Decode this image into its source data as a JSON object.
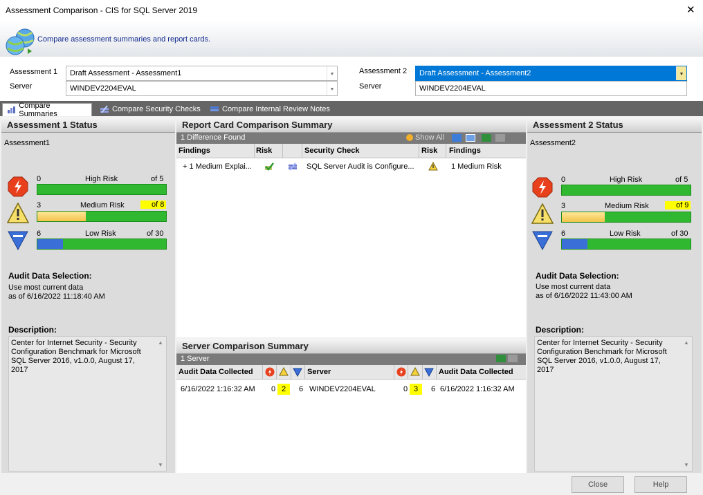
{
  "window": {
    "title": "Assessment Comparison - CIS for SQL Server 2019",
    "close_glyph": "✕"
  },
  "header": {
    "text": "Compare assessment summaries and report cards."
  },
  "selection": {
    "a1_label": "Assessment 1",
    "a1_server_label": "Server",
    "a1_value": "Draft Assessment - Assessment1",
    "a1_server": "WINDEV2204EVAL",
    "a2_label": "Assessment 2",
    "a2_server_label": "Server",
    "a2_value": "Draft Assessment - Assessment2",
    "a2_server": "WINDEV2204EVAL"
  },
  "tabs": [
    {
      "label": "Compare Summaries"
    },
    {
      "label": "Compare Security Checks"
    },
    {
      "label": "Compare Internal Review Notes"
    }
  ],
  "left": {
    "title": "Assessment 1 Status",
    "name": "Assessment1",
    "high": {
      "count": "0",
      "label": "High Risk",
      "of": "of 5",
      "fraction": 0
    },
    "medium": {
      "count": "3",
      "label": "Medium Risk",
      "of": "of 8",
      "fraction": 0.375
    },
    "low": {
      "count": "6",
      "label": "Low Risk",
      "of": "of 30",
      "fraction": 0.2
    },
    "audit_heading": "Audit Data Selection:",
    "audit_line1": "Use most current data",
    "audit_line2": "as of 6/16/2022 11:18:40 AM",
    "desc_heading": "Description:",
    "desc": "Center for Internet Security - Security Configuration Benchmark for Microsoft SQL Server 2016, v1.0.0, August 17, 2017"
  },
  "right": {
    "title": "Assessment 2 Status",
    "name": "Assessment2",
    "high": {
      "count": "0",
      "label": "High Risk",
      "of": "of 5",
      "fraction": 0
    },
    "medium": {
      "count": "3",
      "label": "Medium Risk",
      "of": "of 9",
      "fraction": 0.333
    },
    "low": {
      "count": "6",
      "label": "Low Risk",
      "of": "of 30",
      "fraction": 0.2
    },
    "audit_heading": "Audit Data Selection:",
    "audit_line1": "Use most current data",
    "audit_line2": "as of 6/16/2022 11:43:00 AM",
    "desc_heading": "Description:",
    "desc": "Center for Internet Security - Security Configuration Benchmark for Microsoft SQL Server 2016, v1.0.0, August 17, 2017"
  },
  "report": {
    "title": "Report Card Comparison Summary",
    "found": "1 Difference Found",
    "show_all": "Show All",
    "headers": [
      "Findings",
      "Risk",
      "Security Check",
      "Risk",
      "Findings"
    ],
    "row": {
      "findings1": "+ 1 Medium Explai...",
      "check": "SQL Server Audit is Configure...",
      "findings2": "1 Medium Risk"
    }
  },
  "server": {
    "title": "Server Comparison Summary",
    "count": "1 Server",
    "headers": {
      "audit1": "Audit Data Collected",
      "server": "Server",
      "audit2": "Audit Data Collected"
    },
    "row": {
      "date1": "6/16/2022 1:16:32 AM",
      "h1": "0",
      "m1": "2",
      "l1": "6",
      "server": "WINDEV2204EVAL",
      "h2": "0",
      "m2": "3",
      "l2": "6",
      "date2": "6/16/2022 1:16:32 AM"
    }
  },
  "buttons": {
    "close": "Close",
    "help": "Help"
  },
  "colors": {
    "green": "#30b830",
    "medium_fill": "#f7d25c",
    "low_fill": "#3a6fd8",
    "high_icon": "#e8401c",
    "highlight": "#ffff00"
  }
}
